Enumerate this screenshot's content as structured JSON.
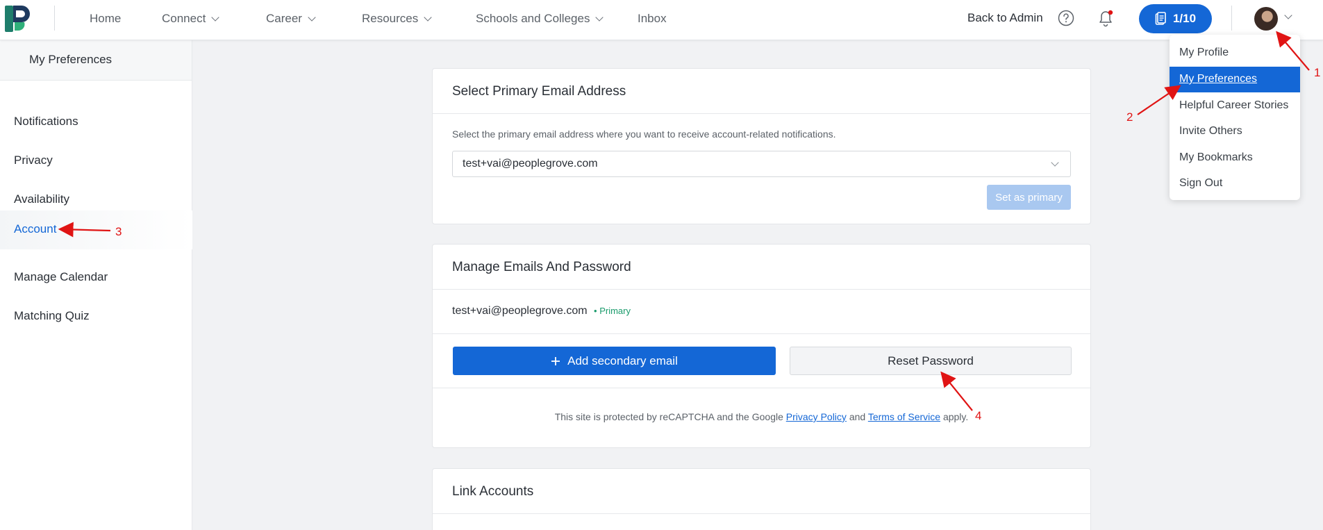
{
  "header": {
    "nav": [
      {
        "label": "Home",
        "has_dropdown": false
      },
      {
        "label": "Connect",
        "has_dropdown": true
      },
      {
        "label": "Career",
        "has_dropdown": true
      },
      {
        "label": "Resources",
        "has_dropdown": true
      },
      {
        "label": "Schools and Colleges",
        "has_dropdown": true
      },
      {
        "label": "Inbox",
        "has_dropdown": false
      }
    ],
    "back_to_admin": "Back to Admin",
    "counter": "1/10",
    "icons": {
      "help": "help-circle-icon",
      "bell": "bell-icon",
      "clipboard": "clipboard-icon"
    },
    "accent_color": "#1467d6",
    "notification_dot_color": "#e01414"
  },
  "sidebar": {
    "heading": "My Preferences",
    "items": [
      {
        "label": "Notifications",
        "active": false
      },
      {
        "label": "Privacy",
        "active": false
      },
      {
        "label": "Availability",
        "active": false
      },
      {
        "label": "Account",
        "active": true
      },
      {
        "label": "Manage Calendar",
        "active": false
      },
      {
        "label": "Matching Quiz",
        "active": false
      }
    ]
  },
  "primary_email_card": {
    "title": "Select Primary Email Address",
    "description": "Select the primary email address where you want to receive account-related notifications.",
    "selected_email": "test+vai@peoplegrove.com",
    "set_primary_label": "Set as primary"
  },
  "manage_card": {
    "title": "Manage Emails And Password",
    "email": "test+vai@peoplegrove.com",
    "primary_badge": "• Primary",
    "add_secondary_label": "Add secondary email",
    "reset_password_label": "Reset Password",
    "recaptcha_prefix": "This site is protected by reCAPTCHA and the Google",
    "privacy_policy": "Privacy Policy",
    "and": "and",
    "terms_of_service": "Terms of Service",
    "apply": "apply."
  },
  "link_accounts_card": {
    "title": "Link Accounts"
  },
  "user_menu": {
    "items": [
      {
        "label": "My Profile",
        "active": false
      },
      {
        "label": "My Preferences",
        "active": true
      },
      {
        "label": "Helpful Career Stories",
        "active": false
      },
      {
        "label": "Invite Others",
        "active": false
      },
      {
        "label": "My Bookmarks",
        "active": false
      },
      {
        "label": "Sign Out",
        "active": false
      }
    ]
  },
  "annotations": {
    "n1": "1",
    "n2": "2",
    "n3": "3",
    "n4": "4",
    "color": "#e01414"
  }
}
